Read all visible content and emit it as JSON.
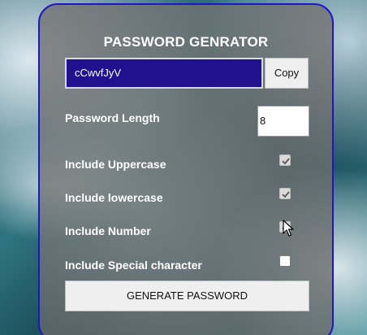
{
  "app": {
    "title": "PASSWORD GENRATOR"
  },
  "password": {
    "value": "cCwvfJyV",
    "copy_label": "Copy"
  },
  "length": {
    "label": "Password Length",
    "value": "8"
  },
  "options": [
    {
      "label": "Include Uppercase",
      "checked": true
    },
    {
      "label": "Include lowercase",
      "checked": true
    },
    {
      "label": "Include Number",
      "checked": true
    },
    {
      "label": "Include Special character",
      "checked": false
    }
  ],
  "generate_label": "GENERATE PASSWORD",
  "colors": {
    "password_bg": "#22118f",
    "card_border": "#1f16c9"
  }
}
